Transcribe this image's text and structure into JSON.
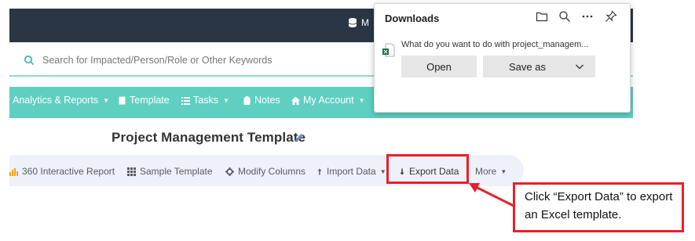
{
  "topbar": {
    "db_label": "M"
  },
  "search": {
    "placeholder": "Search for Impacted/Person/Role or Other Keywords"
  },
  "nav": {
    "items": [
      {
        "label": "Analytics & Reports",
        "icon": "none",
        "has_caret": true
      },
      {
        "label": "Template",
        "icon": "document-icon",
        "has_caret": false
      },
      {
        "label": "Tasks",
        "icon": "list-icon",
        "has_caret": true
      },
      {
        "label": "Notes",
        "icon": "clipboard-icon",
        "has_caret": false
      },
      {
        "label": "My Account",
        "icon": "home-icon",
        "has_caret": true
      }
    ]
  },
  "page": {
    "title": "Project Management Template"
  },
  "toolbar": {
    "items": [
      {
        "label": "360 Interactive Report",
        "icon": "bar-chart-icon"
      },
      {
        "label": "Sample Template",
        "icon": "grid-icon"
      },
      {
        "label": "Modify Columns",
        "icon": "gear-icon"
      },
      {
        "label": "Import Data",
        "icon": "arrow-up-icon"
      },
      {
        "label": "Export Data",
        "icon": "arrow-down-icon"
      },
      {
        "label": "More",
        "icon": "none"
      }
    ]
  },
  "downloads": {
    "title": "Downloads",
    "question": "What do you want to do with project_managem...",
    "open_label": "Open",
    "saveas_label": "Save as"
  },
  "callout": {
    "text": "Click “Export Data” to export an Excel template."
  },
  "colors": {
    "topbar": "#2b3644",
    "nav": "#5fcfc2",
    "highlight": "#e8202a",
    "toolbar_bg": "#eef2f8"
  }
}
